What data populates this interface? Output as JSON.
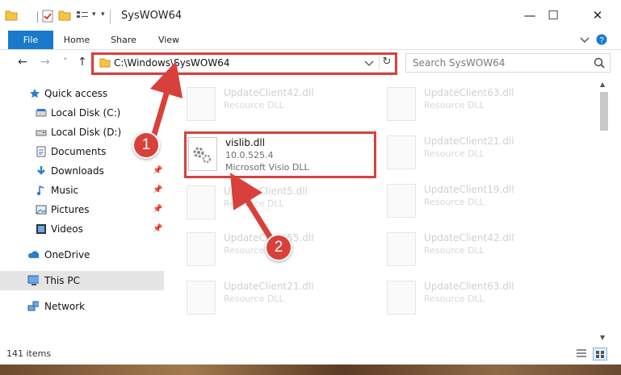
{
  "window": {
    "title": "SysWOW64",
    "controls": {
      "minimize": "—",
      "maximize": "☐",
      "close": "✕"
    }
  },
  "ribbon": {
    "tabs": [
      "File",
      "Home",
      "Share",
      "View"
    ],
    "expand_icon": "chevron-down-icon",
    "help_icon": "help-icon"
  },
  "address_bar": {
    "path": "C:\\Windows\\SysWOW64",
    "dropdown_icon": "chevron-down-icon",
    "refresh_icon": "refresh-icon"
  },
  "search": {
    "placeholder": "Search SysWOW64"
  },
  "nav": {
    "back": "←",
    "forward": "→",
    "recent": "˅",
    "up": "↑"
  },
  "sidebar": {
    "items": [
      {
        "label": "Quick access",
        "icon": "star-icon"
      },
      {
        "label": "Local Disk (C:)",
        "icon": "drive-icon"
      },
      {
        "label": "Local Disk (D:)",
        "icon": "drive-icon"
      },
      {
        "label": "Documents",
        "icon": "documents-icon"
      },
      {
        "label": "Downloads",
        "icon": "download-icon",
        "pinned": true
      },
      {
        "label": "Music",
        "icon": "music-icon",
        "pinned": true
      },
      {
        "label": "Pictures",
        "icon": "pictures-icon",
        "pinned": true
      },
      {
        "label": "Videos",
        "icon": "videos-icon",
        "pinned": true
      },
      {
        "label": "OneDrive",
        "icon": "cloud-icon"
      },
      {
        "label": "This PC",
        "icon": "computer-icon",
        "selected": true
      },
      {
        "label": "Network",
        "icon": "network-icon"
      }
    ]
  },
  "files": {
    "left": [
      {
        "name": "UpdateClient42.dll",
        "sub": "Resource DLL"
      },
      {
        "name": "vislib.dll",
        "version": "10.0.525.4",
        "sub": "Microsoft Visio DLL",
        "highlighted": true
      },
      {
        "name": "UpdateClient5.dll",
        "sub": "Resource DLL"
      },
      {
        "name": "UpdateClient55.dll",
        "sub": "Resource DLL"
      },
      {
        "name": "UpdateClient21.dll",
        "sub": "Resource DLL"
      }
    ],
    "right": [
      {
        "name": "UpdateClient63.dll",
        "sub": "Resource DLL"
      },
      {
        "name": "UpdateClient21.dll",
        "sub": "Resource DLL"
      },
      {
        "name": "UpdateClient19.dll",
        "sub": "Resource DLL"
      },
      {
        "name": "UpdateClient42.dll",
        "sub": "Resource DLL"
      },
      {
        "name": "UpdateClient63.dll",
        "sub": "Resource DLL"
      }
    ]
  },
  "status": {
    "item_count": "141 items"
  },
  "annotations": {
    "step1": "1",
    "step2": "2",
    "accent": "#d8413b"
  },
  "colors": {
    "file_tab": "#1979ca",
    "selection": "#e5e5e5"
  }
}
